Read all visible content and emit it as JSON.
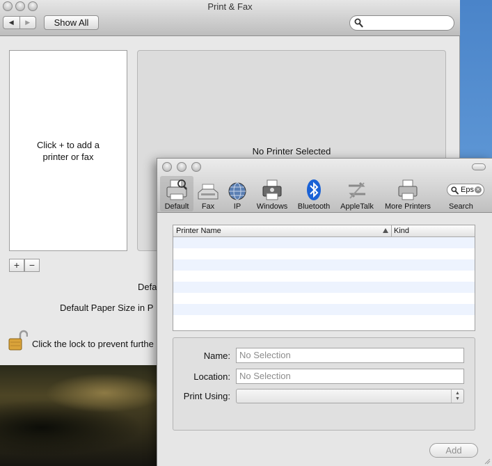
{
  "main_window": {
    "title": "Print & Fax",
    "nav_back": "◀",
    "nav_forward": "▶",
    "show_all": "Show All",
    "search": {
      "value": ""
    },
    "printer_list_hint": "Click + to add a printer or fax",
    "detail_text": "No Printer Selected",
    "add_symbol": "+",
    "remove_symbol": "−",
    "default_label": "Defa",
    "paper_size_label": "Default Paper Size in P",
    "lock_text": "Click the lock to prevent furthe"
  },
  "add_window": {
    "toolbar": [
      {
        "label": "Default",
        "icon": "default-printer-icon",
        "selected": true
      },
      {
        "label": "Fax",
        "icon": "fax-icon"
      },
      {
        "label": "IP",
        "icon": "globe-icon"
      },
      {
        "label": "Windows",
        "icon": "windows-printer-icon"
      },
      {
        "label": "Bluetooth",
        "icon": "bluetooth-icon"
      },
      {
        "label": "AppleTalk",
        "icon": "appletalk-icon"
      },
      {
        "label": "More Printers",
        "icon": "more-printers-icon"
      }
    ],
    "search": {
      "value": "Eps",
      "label": "Search"
    },
    "table": {
      "columns": [
        "Printer Name",
        "Kind"
      ],
      "sorted_column": "Printer Name",
      "rows": []
    },
    "fields": {
      "name": {
        "label": "Name:",
        "value": "No Selection"
      },
      "location": {
        "label": "Location:",
        "value": "No Selection"
      },
      "print_using": {
        "label": "Print Using:",
        "value": ""
      }
    },
    "add_button": "Add"
  },
  "colors": {
    "row_stripe": "#edf3fe",
    "bluetooth": "#1a62d6",
    "lock_gold": "#d9a33a"
  }
}
